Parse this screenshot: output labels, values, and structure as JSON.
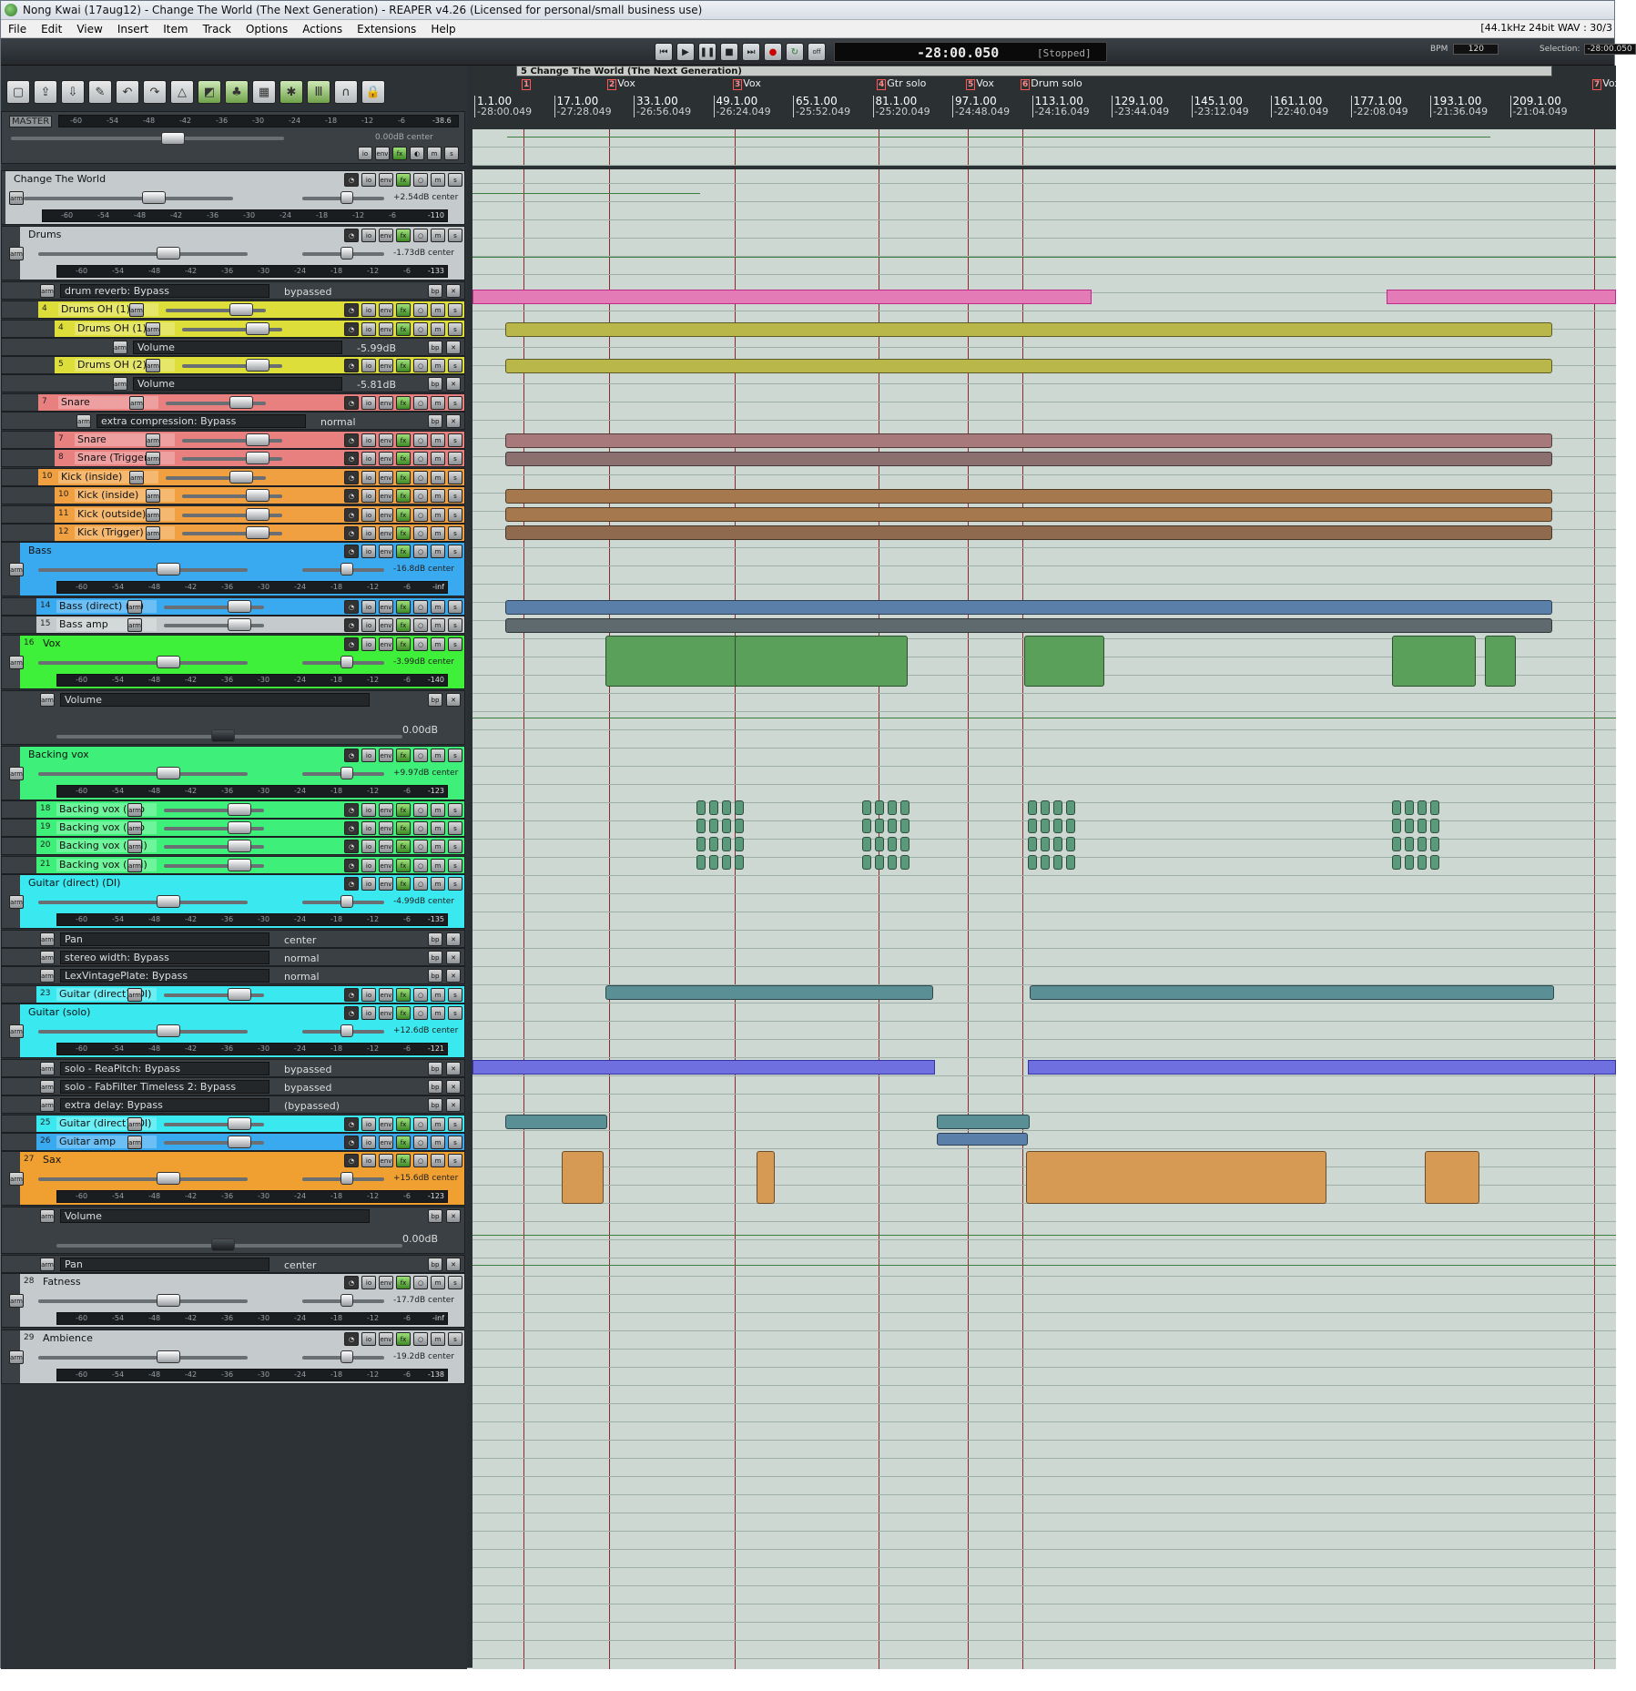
{
  "window": {
    "title": "Nong Kwai (17aug12) - Change The World (The Next Generation) - REAPER v4.26 (Licensed for personal/small business use)",
    "status": "[44.1kHz 24bit WAV : 30/3"
  },
  "menu": [
    "File",
    "Edit",
    "View",
    "Insert",
    "Item",
    "Track",
    "Options",
    "Actions",
    "Extensions",
    "Help"
  ],
  "transport": {
    "time": "-28:00.050",
    "state": "[Stopped]",
    "bpm_label": "BPM",
    "bpm": "120",
    "selection_label": "Selection:",
    "selection": "-28:00.050"
  },
  "master": {
    "label": "MASTER",
    "vol": "0.00dB center",
    "peak": "-38.6",
    "scale": [
      "-60",
      "-54",
      "-48",
      "-42",
      "-36",
      "-30",
      "-24",
      "-18",
      "-12",
      "-6"
    ]
  },
  "tracks": [
    {
      "num": "",
      "name": "Change The World",
      "vol": "+2.54dB center",
      "peak": "-110",
      "color": "#c5cbcd"
    },
    {
      "num": "",
      "name": "Drums",
      "vol": "-1.73dB center",
      "peak": "-133",
      "color": "#c5cbcd"
    },
    {
      "num": "4",
      "name": "Drums OH (1)",
      "color": "#dede3a"
    },
    {
      "num": "5",
      "name": "Drums OH (2)",
      "color": "#dede3a"
    },
    {
      "num": "7",
      "name": "Snare",
      "color": "#e98080"
    },
    {
      "num": "8",
      "name": "Snare (Trigger)",
      "color": "#e98080"
    },
    {
      "num": "10",
      "name": "Kick (inside)",
      "color": "#f0a040"
    },
    {
      "num": "11",
      "name": "Kick (outside)",
      "color": "#f0a040"
    },
    {
      "num": "12",
      "name": "Kick (Trigger)",
      "color": "#f0a040"
    },
    {
      "num": "",
      "name": "Bass",
      "vol": "-16.8dB center",
      "peak": "-inf",
      "color": "#3aaaf0"
    },
    {
      "num": "14",
      "name": "Bass (direct) (DI)",
      "color": "#3aaaf0"
    },
    {
      "num": "15",
      "name": "Bass amp",
      "color": "#c5cbcd"
    },
    {
      "num": "16",
      "name": "Vox",
      "vol": "-3.99dB center",
      "peak": "-140",
      "color": "#3ef03a"
    },
    {
      "num": "",
      "name": "Backing vox",
      "vol": "+9.97dB center",
      "peak": "-123",
      "color": "#3ef07a"
    },
    {
      "num": "18",
      "name": "Backing vox (Pao",
      "color": "#3ef07a"
    },
    {
      "num": "19",
      "name": "Backing vox (Pao",
      "color": "#3ef07a"
    },
    {
      "num": "20",
      "name": "Backing vox (Hoi)",
      "color": "#3ef07a"
    },
    {
      "num": "21",
      "name": "Backing vox (Hoi)",
      "color": "#3ef07a"
    },
    {
      "num": "",
      "name": "Guitar (direct) (DI)",
      "vol": "-4.99dB center",
      "peak": "-135",
      "color": "#3ae8f0"
    },
    {
      "num": "23",
      "name": "Guitar (direct) (DI)",
      "color": "#3ae8f0"
    },
    {
      "num": "",
      "name": "Guitar (solo)",
      "vol": "+12.6dB center",
      "peak": "-121",
      "color": "#3ae8f0"
    },
    {
      "num": "25",
      "name": "Guitar (direct) (DI)",
      "color": "#3ae8f0"
    },
    {
      "num": "26",
      "name": "Guitar amp",
      "color": "#3aaaf0"
    },
    {
      "num": "27",
      "name": "Sax",
      "vol": "+15.6dB center",
      "peak": "-123",
      "color": "#f0a030"
    },
    {
      "num": "28",
      "name": "Fatness",
      "vol": "-17.7dB center",
      "peak": "-inf",
      "color": "#c5cbcd"
    },
    {
      "num": "29",
      "name": "Ambience",
      "vol": "-19.2dB center",
      "peak": "-138",
      "color": "#c5cbcd"
    }
  ],
  "envelopes": {
    "drum_reverb": {
      "label": "drum reverb: Bypass",
      "val": "bypassed"
    },
    "oh1_volume": {
      "label": "Volume",
      "val": "-5.99dB"
    },
    "oh2_volume": {
      "label": "Volume",
      "val": "-5.81dB"
    },
    "snare_comp": {
      "label": "extra compression: Bypass",
      "val": "normal"
    },
    "vox_volume": {
      "label": "Volume",
      "val": "0.00dB"
    },
    "gtr_pan": {
      "label": "Pan",
      "val": "center"
    },
    "gtr_width": {
      "label": "stereo width: Bypass",
      "val": "normal"
    },
    "gtr_plate": {
      "label": "LexVintagePlate: Bypass",
      "val": "normal"
    },
    "solo_pitch": {
      "label": "solo - ReaPitch: Bypass",
      "val": "bypassed"
    },
    "solo_timeless": {
      "label": "solo - FabFilter Timeless 2: Bypass",
      "val": "bypassed"
    },
    "solo_delay": {
      "label": "extra delay: Bypass",
      "val": "(bypassed)"
    },
    "sax_volume": {
      "label": "Volume",
      "val": "0.00dB"
    },
    "sax_pan": {
      "label": "Pan",
      "val": "center"
    }
  },
  "timeline": {
    "region": "5 Change The World (The Next Generation)",
    "markers": [
      {
        "n": "1",
        "label": ""
      },
      {
        "n": "2",
        "label": "Vox"
      },
      {
        "n": "3",
        "label": "Vox"
      },
      {
        "n": "4",
        "label": "Gtr solo"
      },
      {
        "n": "5",
        "label": "Vox"
      },
      {
        "n": "6",
        "label": "Drum solo"
      },
      {
        "n": "7",
        "label": "Vox"
      }
    ],
    "ticks": [
      {
        "bar": "1.1.00",
        "time": "-28:00.049"
      },
      {
        "bar": "17.1.00",
        "time": "-27:28.049"
      },
      {
        "bar": "33.1.00",
        "time": "-26:56.049"
      },
      {
        "bar": "49.1.00",
        "time": "-26:24.049"
      },
      {
        "bar": "65.1.00",
        "time": "-25:52.049"
      },
      {
        "bar": "81.1.00",
        "time": "-25:20.049"
      },
      {
        "bar": "97.1.00",
        "time": "-24:48.049"
      },
      {
        "bar": "113.1.00",
        "time": "-24:16.049"
      },
      {
        "bar": "129.1.00",
        "time": "-23:44.049"
      },
      {
        "bar": "145.1.00",
        "time": "-23:12.049"
      },
      {
        "bar": "161.1.00",
        "time": "-22:40.049"
      },
      {
        "bar": "177.1.00",
        "time": "-22:08.049"
      },
      {
        "bar": "193.1.00",
        "time": "-21:36.049"
      },
      {
        "bar": "209.1.00",
        "time": "-21:04.049"
      }
    ]
  },
  "icons": [
    "new-project-icon",
    "open-icon",
    "save-icon",
    "settings-icon",
    "undo-icon",
    "redo-icon",
    "metronome-icon",
    "snap-icon",
    "ripple-icon",
    "grid-icon",
    "envelope-icon",
    "lock-icon",
    "headphones-icon"
  ]
}
